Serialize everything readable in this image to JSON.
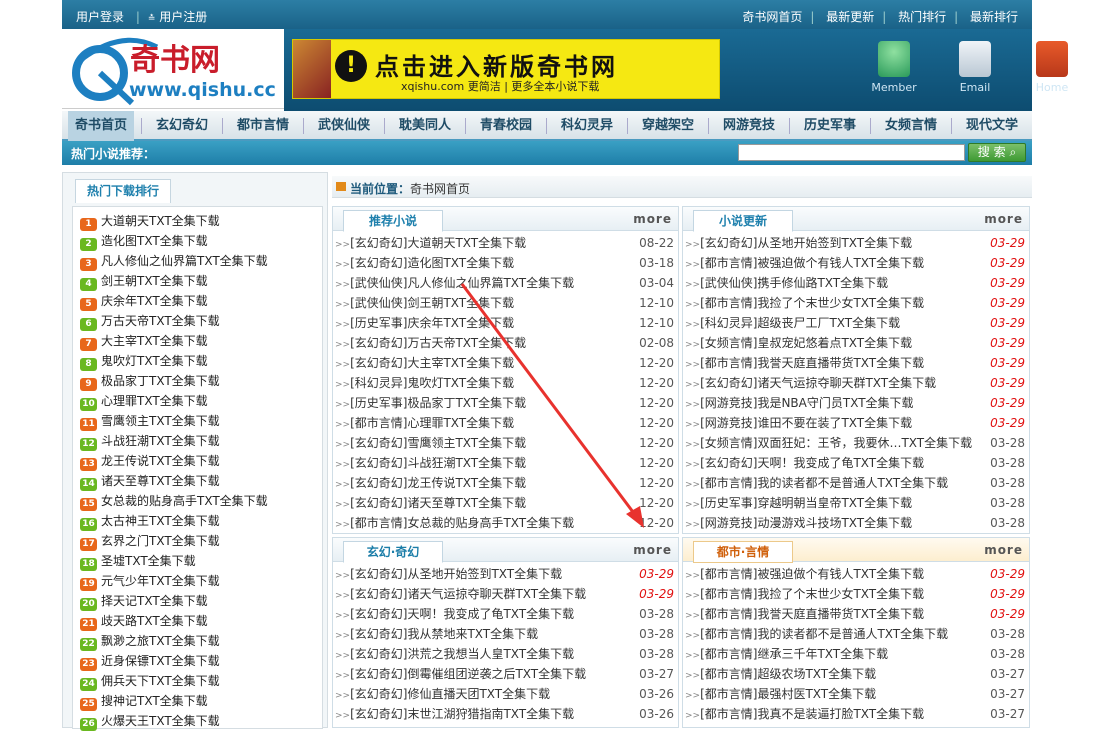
{
  "topbar": {
    "login": "用户登录",
    "register": "用户注册",
    "links": [
      "奇书网首页",
      "最新更新",
      "热门排行",
      "最新排行"
    ]
  },
  "logo": {
    "name": "奇书网",
    "url_text": "www.qishu.cc"
  },
  "banner": {
    "main": "点击进入新版奇书网",
    "sub": "xqishu.com 更简洁 | 更多全本小说下载"
  },
  "header_icons": [
    "Member",
    "Email",
    "Home"
  ],
  "nav": [
    "奇书首页",
    "玄幻奇幻",
    "都市言情",
    "武侠仙侠",
    "耽美同人",
    "青春校园",
    "科幻灵异",
    "穿越架空",
    "网游竞技",
    "历史军事",
    "女频言情",
    "现代文学"
  ],
  "hotbar": {
    "label": "热门小说推荐：",
    "search_btn": "搜 索"
  },
  "sidebar": {
    "title": "热门下载排行",
    "items": [
      "大道朝天TXT全集下载",
      "造化图TXT全集下载",
      "凡人修仙之仙界篇TXT全集下载",
      "剑王朝TXT全集下载",
      "庆余年TXT全集下载",
      "万古天帝TXT全集下载",
      "大主宰TXT全集下载",
      "鬼吹灯TXT全集下载",
      "极品家丁TXT全集下载",
      "心理罪TXT全集下载",
      "雪鹰领主TXT全集下载",
      "斗战狂潮TXT全集下载",
      "龙王传说TXT全集下载",
      "诸天至尊TXT全集下载",
      "女总裁的贴身高手TXT全集下载",
      "太古神王TXT全集下载",
      "玄界之门TXT全集下载",
      "圣墟TXT全集下载",
      "元气少年TXT全集下载",
      "择天记TXT全集下载",
      "歧天路TXT全集下载",
      "飘渺之旅TXT全集下载",
      "近身保镖TXT全集下载",
      "佣兵天下TXT全集下载",
      "搜神记TXT全集下载",
      "火爆天王TXT全集下载"
    ]
  },
  "crumb": {
    "label": "当前位置：",
    "value": "奇书网首页"
  },
  "panels": [
    {
      "title": "推荐小说",
      "more": "more",
      "rows": [
        [
          "[玄幻奇幻]大道朝天TXT全集下载",
          "08-22"
        ],
        [
          "[玄幻奇幻]造化图TXT全集下载",
          "03-18"
        ],
        [
          "[武侠仙侠]凡人修仙之仙界篇TXT全集下载",
          "03-04"
        ],
        [
          "[武侠仙侠]剑王朝TXT全集下载",
          "12-10"
        ],
        [
          "[历史军事]庆余年TXT全集下载",
          "12-10"
        ],
        [
          "[玄幻奇幻]万古天帝TXT全集下载",
          "02-08"
        ],
        [
          "[玄幻奇幻]大主宰TXT全集下载",
          "12-20"
        ],
        [
          "[科幻灵异]鬼吹灯TXT全集下载",
          "12-20"
        ],
        [
          "[历史军事]极品家丁TXT全集下载",
          "12-20"
        ],
        [
          "[都市言情]心理罪TXT全集下载",
          "12-20"
        ],
        [
          "[玄幻奇幻]雪鹰领主TXT全集下载",
          "12-20"
        ],
        [
          "[玄幻奇幻]斗战狂潮TXT全集下载",
          "12-20"
        ],
        [
          "[玄幻奇幻]龙王传说TXT全集下载",
          "12-20"
        ],
        [
          "[玄幻奇幻]诸天至尊TXT全集下载",
          "12-20"
        ],
        [
          "[都市言情]女总裁的贴身高手TXT全集下载",
          "12-20"
        ]
      ]
    },
    {
      "title": "小说更新",
      "more": "more",
      "rows": [
        [
          "[玄幻奇幻]从圣地开始签到TXT全集下载",
          "03-29"
        ],
        [
          "[都市言情]被强迫做个有钱人TXT全集下载",
          "03-29"
        ],
        [
          "[武侠仙侠]携手修仙路TXT全集下载",
          "03-29"
        ],
        [
          "[都市言情]我捡了个末世少女TXT全集下载",
          "03-29"
        ],
        [
          "[科幻灵异]超级丧尸工厂TXT全集下载",
          "03-29"
        ],
        [
          "[女频言情]皇叔宠妃悠着点TXT全集下载",
          "03-29"
        ],
        [
          "[都市言情]我誉天庭直播带货TXT全集下载",
          "03-29"
        ],
        [
          "[玄幻奇幻]诸天气运掠夺聊天群TXT全集下载",
          "03-29"
        ],
        [
          "[网游竞技]我是NBA守门员TXT全集下载",
          "03-29"
        ],
        [
          "[网游竞技]谁田不要在装了TXT全集下载",
          "03-29"
        ],
        [
          "[女频言情]双面狂妃：王爷，我要休…TXT全集下载",
          "03-28"
        ],
        [
          "[玄幻奇幻]天啊！我变成了龟TXT全集下载",
          "03-28"
        ],
        [
          "[都市言情]我的读者都不是普通人TXT全集下载",
          "03-28"
        ],
        [
          "[历史军事]穿越明朝当皇帝TXT全集下载",
          "03-28"
        ],
        [
          "[网游竞技]动漫游戏斗技场TXT全集下载",
          "03-28"
        ]
      ]
    },
    {
      "title": "玄幻·奇幻",
      "more": "more",
      "rows": [
        [
          "[玄幻奇幻]从圣地开始签到TXT全集下载",
          "03-29"
        ],
        [
          "[玄幻奇幻]诸天气运掠夺聊天群TXT全集下载",
          "03-29"
        ],
        [
          "[玄幻奇幻]天啊！我变成了龟TXT全集下载",
          "03-28"
        ],
        [
          "[玄幻奇幻]我从禁地来TXT全集下载",
          "03-28"
        ],
        [
          "[玄幻奇幻]洪荒之我想当人皇TXT全集下载",
          "03-28"
        ],
        [
          "[玄幻奇幻]倒霉催组团逆袭之后TXT全集下载",
          "03-27"
        ],
        [
          "[玄幻奇幻]修仙直播天团TXT全集下载",
          "03-26"
        ],
        [
          "[玄幻奇幻]末世江湖狩猎指南TXT全集下载",
          "03-26"
        ]
      ]
    },
    {
      "title": "都市·言情",
      "more": "more",
      "rows": [
        [
          "[都市言情]被强迫做个有钱人TXT全集下载",
          "03-29"
        ],
        [
          "[都市言情]我捡了个末世少女TXT全集下载",
          "03-29"
        ],
        [
          "[都市言情]我誉天庭直播带货TXT全集下载",
          "03-29"
        ],
        [
          "[都市言情]我的读者都不是普通人TXT全集下载",
          "03-28"
        ],
        [
          "[都市言情]继承三千年TXT全集下载",
          "03-28"
        ],
        [
          "[都市言情]超级农场TXT全集下载",
          "03-27"
        ],
        [
          "[都市言情]最强村医TXT全集下载",
          "03-27"
        ],
        [
          "[都市言情]我真不是装逼打脸TXT全集下载",
          "03-27"
        ]
      ]
    }
  ],
  "hot_date": "03-29"
}
